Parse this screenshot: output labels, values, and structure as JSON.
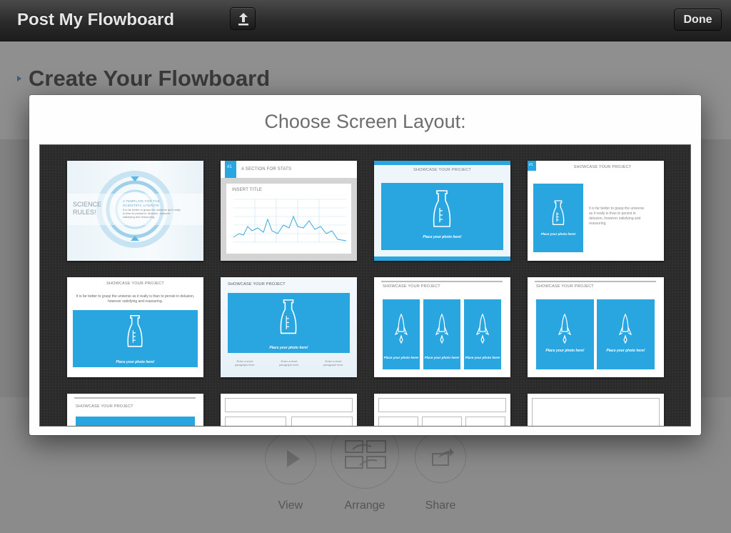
{
  "header": {
    "title": "Post My Flowboard",
    "upload_icon": "upload-icon",
    "done_label": "Done"
  },
  "background": {
    "heading": "Create Your Flowboard",
    "tools": [
      {
        "label": "View",
        "icon": "play-icon"
      },
      {
        "label": "Arrange",
        "icon": "arrange-icon"
      },
      {
        "label": "Share",
        "icon": "share-icon"
      }
    ]
  },
  "modal": {
    "title": "Choose Screen Layout:"
  },
  "layouts": {
    "t1": {
      "title": "SCIENCE RULES!",
      "sub": "A TEMPLATE FOR THE SCIENTIFIC LITERATE",
      "para": "It is far better to grasp the universe as it really is than to persist in delusion, however satisfying and reassuring."
    },
    "t2": {
      "badge": "#1",
      "section": "A SECTION FOR STATS",
      "title": "INSERT TITLE"
    },
    "t3": {
      "title": "SHOWCASE YOUR PROJECT",
      "photo": "Place your photo here!"
    },
    "t4": {
      "badge": "#1",
      "title": "SHOWCASE YOUR PROJECT",
      "photo": "Place your photo here!",
      "para": "It is far better to grasp the universe as it really is than to persist in delusion, however satisfying and reassuring."
    },
    "t5": {
      "title": "SHOWCASE YOUR PROJECT",
      "para": "It is far better to grasp the universe as it really is than to persist in delusion, however satisfying and reassuring.",
      "photo": "Place your photo here!"
    },
    "t6": {
      "title": "SHOWCASE YOUR PROJECT",
      "photo": "Place your photo here!",
      "short": "Enter a short paragraph here."
    },
    "t7": {
      "title": "SHOWCASE YOUR PROJECT",
      "photo": "Place your photo here!"
    },
    "t8": {
      "title": "SHOWCASE YOUR PROJECT",
      "photo": "Place your photo here!"
    },
    "t9": {
      "title": "SHOWCASE YOUR PROJECT"
    }
  },
  "colors": {
    "accent": "#29a5e0",
    "topbar": "#2a2a2a"
  }
}
